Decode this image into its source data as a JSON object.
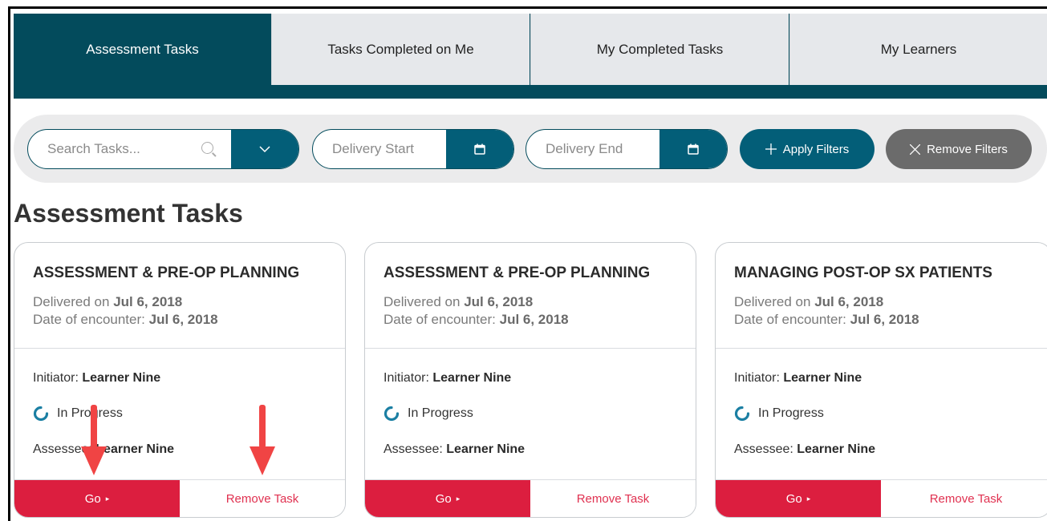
{
  "tabs": [
    {
      "label": "Assessment Tasks",
      "active": true
    },
    {
      "label": "Tasks Completed on Me",
      "active": false
    },
    {
      "label": "My Completed Tasks",
      "active": false
    },
    {
      "label": "My Learners",
      "active": false
    }
  ],
  "filters": {
    "search_placeholder": "Search Tasks...",
    "delivery_start_placeholder": "Delivery Start",
    "delivery_end_placeholder": "Delivery End",
    "apply_label": "Apply Filters",
    "remove_label": "Remove Filters"
  },
  "page_title": "Assessment Tasks",
  "cards": [
    {
      "title": "ASSESSMENT & PRE-OP PLANNING",
      "delivered_label": "Delivered on",
      "delivered_date": "Jul 6, 2018",
      "encounter_label": "Date of encounter:",
      "encounter_date": "Jul 6, 2018",
      "initiator_label": "Initiator:",
      "initiator": "Learner Nine",
      "status": "In Progress",
      "assessee_label": "Assessee:",
      "assessee": "Learner Nine",
      "go_label": "Go",
      "remove_label": "Remove Task"
    },
    {
      "title": "ASSESSMENT & PRE-OP PLANNING",
      "delivered_label": "Delivered on",
      "delivered_date": "Jul 6, 2018",
      "encounter_label": "Date of encounter:",
      "encounter_date": "Jul 6, 2018",
      "initiator_label": "Initiator:",
      "initiator": "Learner Nine",
      "status": "In Progress",
      "assessee_label": "Assessee:",
      "assessee": "Learner Nine",
      "go_label": "Go",
      "remove_label": "Remove Task"
    },
    {
      "title": "MANAGING POST-OP SX PATIENTS",
      "delivered_label": "Delivered on",
      "delivered_date": "Jul 6, 2018",
      "encounter_label": "Date of encounter:",
      "encounter_date": "Jul 6, 2018",
      "initiator_label": "Initiator:",
      "initiator": "Learner Nine",
      "status": "In Progress",
      "assessee_label": "Assessee:",
      "assessee": "Learner Nine",
      "go_label": "Go",
      "remove_label": "Remove Task"
    }
  ],
  "colors": {
    "primary": "#034b5c",
    "button_teal": "#035e78",
    "go_red": "#dc1e3f",
    "remove_gray": "#6b6b6b",
    "annotation_red": "#f04444"
  }
}
